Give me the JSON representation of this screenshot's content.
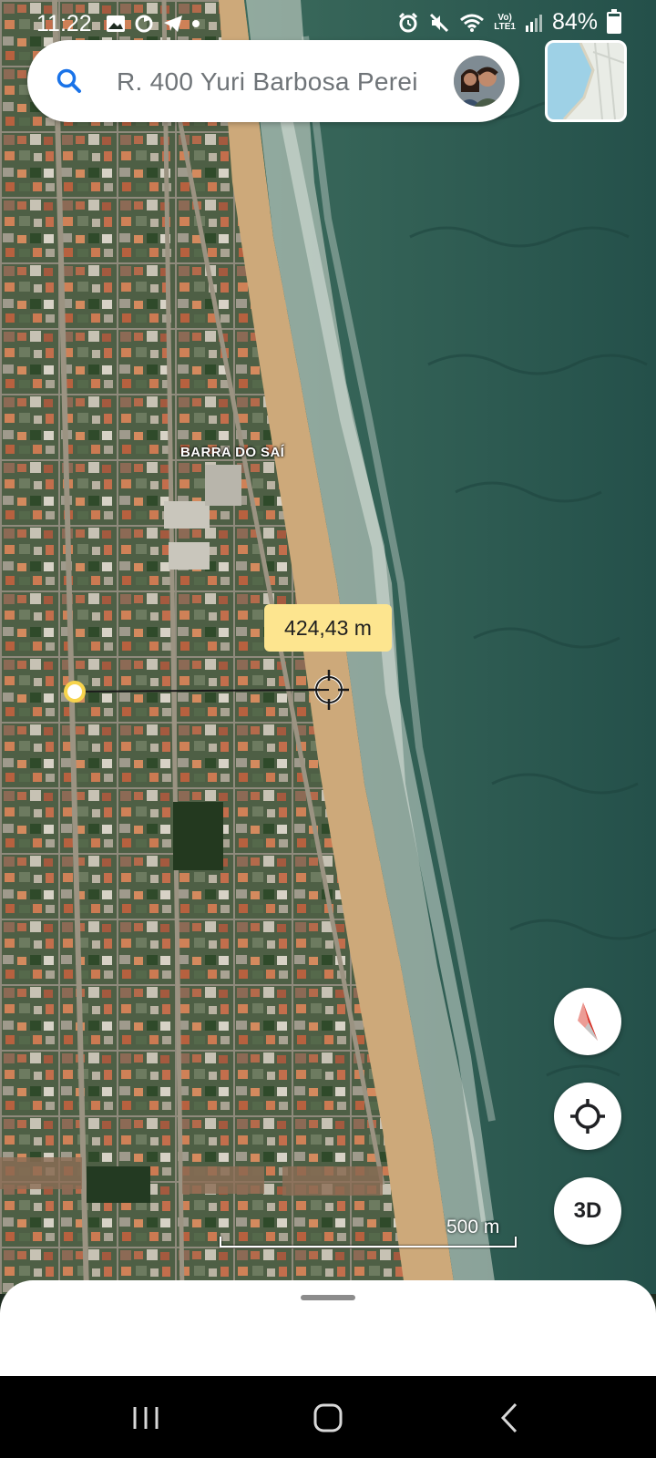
{
  "status_bar": {
    "time": "11:22",
    "battery_percent": "84%",
    "battery_level": 0.84,
    "network_label": "Vo) LTE1",
    "icons": [
      "gallery-icon",
      "sync-icon",
      "telegram-icon",
      "dot-icon",
      "alarm-icon",
      "mute-icon",
      "wifi-icon",
      "signal-icon",
      "battery-icon"
    ]
  },
  "search": {
    "text": "R. 400 Yuri Barbosa Perei",
    "icon": "search-icon",
    "avatar": "profile-avatar"
  },
  "map": {
    "place_label": "BARRA DO SAÍ",
    "distance": "424,43 m",
    "scale_label": "500 m",
    "colors": {
      "ocean": "#2c5a4e",
      "sand": "#cda97a",
      "measure_dot": "#f7d44c",
      "distance_tag": "#fde58f"
    }
  },
  "controls": {
    "compass_icon": "compass-icon",
    "location_icon": "my-location-icon",
    "three_d_label": "3D",
    "layers_icon": "map-layers-thumbnail"
  },
  "navigation": {
    "recents_icon": "recents-icon",
    "home_icon": "home-icon",
    "back_icon": "back-icon"
  }
}
